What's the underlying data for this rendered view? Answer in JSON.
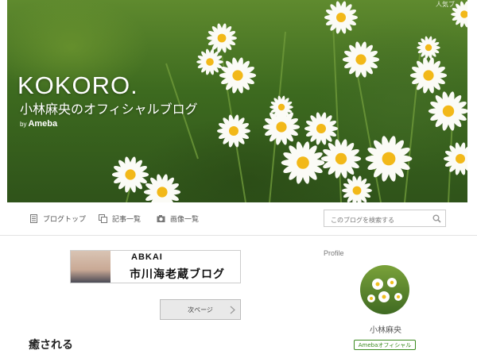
{
  "header": {
    "title": "KOKORO.",
    "subtitle": "小林麻央のオフィシャルブログ",
    "by_prefix": "by",
    "by_brand": "Ameba",
    "corner_text": "人気ブ"
  },
  "nav": {
    "items": [
      {
        "label": "ブログトップ",
        "icon": "document-icon"
      },
      {
        "label": "記事一覧",
        "icon": "list-icon"
      },
      {
        "label": "画像一覧",
        "icon": "camera-icon"
      }
    ],
    "search": {
      "placeholder": "このブログを検索する",
      "icon": "search-icon"
    }
  },
  "banner": {
    "label_en": "ABKAI",
    "label_jp": "市川海老蔵ブログ"
  },
  "pagination": {
    "next_label": "次ページ"
  },
  "post": {
    "title": "癒される"
  },
  "sidebar": {
    "profile_heading": "Profile",
    "name": "小林麻央",
    "badge": "Amebaオフィシャル"
  },
  "colors": {
    "accent_green": "#3b8a1f",
    "header_green": "#3d6a1f"
  }
}
